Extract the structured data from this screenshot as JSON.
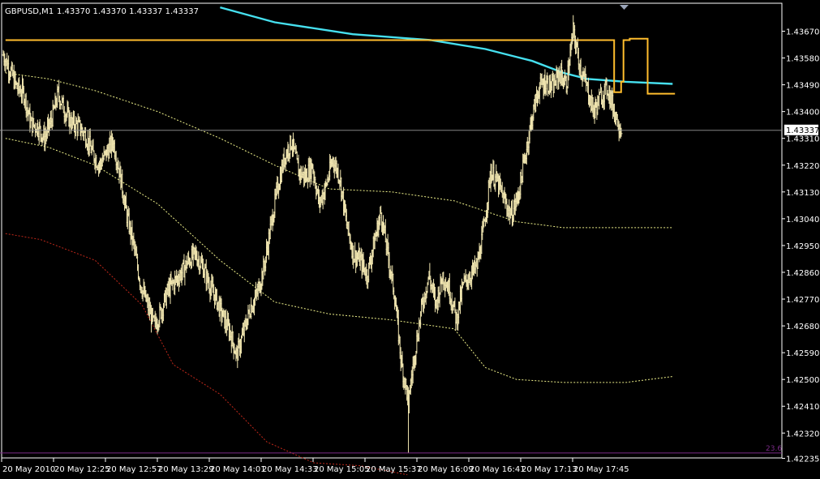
{
  "header": {
    "symbol": "GBPUSD,M1",
    "quote": "1.43370 1.43370 1.43337 1.43337"
  },
  "current_price_label": "1.43337",
  "fib_label": "23.6",
  "colors": {
    "background": "#000000",
    "bars": "#f1e6b0",
    "ma_cyan": "#46e0ef",
    "level_orange": "#ffbd2d",
    "band_yellow": "#eef08a",
    "band_red": "#c0281a",
    "fib_purple": "#7a2a86",
    "axis": "#ffffff",
    "price_line": "#9a9a9a"
  },
  "chart_data": {
    "type": "ohlc",
    "title": "GBPUSD,M1",
    "ylim": [
      1.42235,
      1.4371
    ],
    "y_ticks": [
      "1.43670",
      "1.43580",
      "1.43490",
      "1.43400",
      "1.43310",
      "1.43220",
      "1.43130",
      "1.43040",
      "1.42950",
      "1.42860",
      "1.42770",
      "1.42680",
      "1.42590",
      "1.42500",
      "1.42410",
      "1.42320",
      "1.42235"
    ],
    "x_ticks": [
      "20 May 2010",
      "20 May 12:25",
      "20 May 12:57",
      "20 May 13:29",
      "20 May 14:01",
      "20 May 14:33",
      "20 May 15:05",
      "20 May 15:37",
      "20 May 16:09",
      "20 May 16:41",
      "20 May 17:13",
      "20 May 17:45"
    ],
    "price_path": [
      1.4359,
      1.4354,
      1.4348,
      1.4346,
      1.4336,
      1.4335,
      1.4331,
      1.4337,
      1.4346,
      1.434,
      1.4336,
      1.4335,
      1.4332,
      1.4326,
      1.4322,
      1.4326,
      1.433,
      1.4319,
      1.4305,
      1.4295,
      1.4282,
      1.4275,
      1.4268,
      1.4273,
      1.428,
      1.4283,
      1.4286,
      1.429,
      1.4292,
      1.4288,
      1.4282,
      1.4277,
      1.4271,
      1.4266,
      1.4258,
      1.4266,
      1.4274,
      1.4279,
      1.4288,
      1.4302,
      1.4315,
      1.4325,
      1.433,
      1.432,
      1.4318,
      1.4322,
      1.4309,
      1.4315,
      1.4324,
      1.4318,
      1.4302,
      1.4292,
      1.429,
      1.4285,
      1.4296,
      1.4306,
      1.4292,
      1.4278,
      1.4255,
      1.4243,
      1.426,
      1.4275,
      1.4285,
      1.4275,
      1.4285,
      1.428,
      1.427,
      1.4282,
      1.4285,
      1.4288,
      1.4301,
      1.432,
      1.4316,
      1.431,
      1.4305,
      1.4312,
      1.4325,
      1.4338,
      1.4348,
      1.435,
      1.4348,
      1.4353,
      1.4349,
      1.4367,
      1.4355,
      1.4348,
      1.434,
      1.4345,
      1.4348,
      1.434,
      1.43337
    ],
    "series": [
      {
        "name": "MA",
        "color": "#46e0ef",
        "x": [
          0.28,
          0.35,
          0.45,
          0.55,
          0.62,
          0.68,
          0.72,
          0.75,
          0.8,
          0.86
        ],
        "y": [
          1.4375,
          1.437,
          1.4366,
          1.4364,
          1.4361,
          1.4357,
          1.4353,
          1.4351,
          1.435,
          1.43493
        ]
      },
      {
        "name": "Level",
        "color": "#ffbd2d",
        "x": [
          0.005,
          0.785,
          0.785,
          0.794,
          0.794,
          0.797,
          0.797,
          0.805,
          0.805,
          0.828,
          0.828,
          0.863
        ],
        "y": [
          1.4364,
          1.4364,
          1.43465,
          1.43465,
          1.435,
          1.435,
          1.4364,
          1.4364,
          1.43645,
          1.43645,
          1.4346,
          1.4346
        ]
      },
      {
        "name": "Band upper",
        "color": "#eef08a",
        "x": [
          0.005,
          0.06,
          0.12,
          0.2,
          0.28,
          0.35,
          0.42,
          0.5,
          0.58,
          0.66,
          0.72,
          0.8,
          0.86
        ],
        "y": [
          1.4353,
          1.4351,
          1.4347,
          1.434,
          1.4331,
          1.4322,
          1.4314,
          1.4313,
          1.431,
          1.4303,
          1.4301,
          1.4301,
          1.4301
        ]
      },
      {
        "name": "Band lower",
        "color": "#eef08a",
        "x": [
          0.005,
          0.06,
          0.12,
          0.2,
          0.28,
          0.35,
          0.42,
          0.5,
          0.58,
          0.62,
          0.66,
          0.72,
          0.8,
          0.86
        ],
        "y": [
          1.4331,
          1.4328,
          1.4322,
          1.4309,
          1.429,
          1.4276,
          1.4272,
          1.427,
          1.4267,
          1.4254,
          1.425,
          1.4249,
          1.4249,
          1.4251
        ]
      },
      {
        "name": "Band red",
        "color": "#c0281a",
        "x": [
          0.005,
          0.05,
          0.12,
          0.18,
          0.22,
          0.28,
          0.34,
          0.4,
          0.46,
          0.52
        ],
        "y": [
          1.4299,
          1.4297,
          1.429,
          1.4275,
          1.4255,
          1.4245,
          1.4229,
          1.4222,
          1.4221,
          1.4218
        ]
      }
    ],
    "fib_level": 1.42253,
    "current_price": 1.43337
  }
}
